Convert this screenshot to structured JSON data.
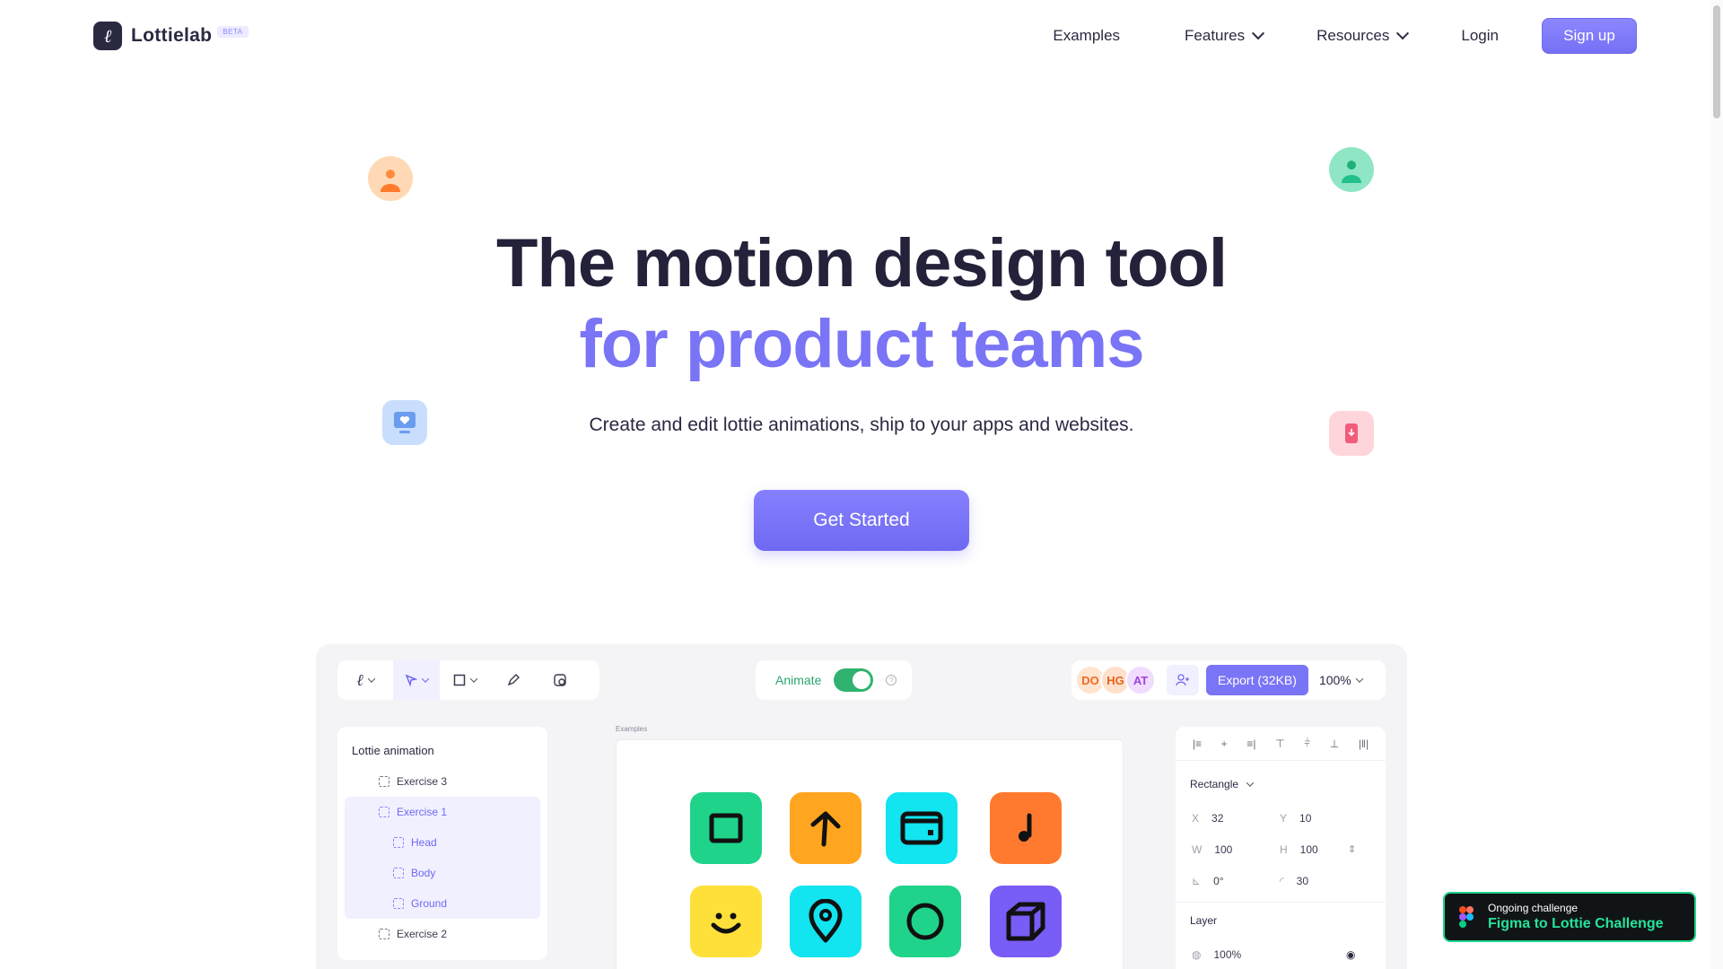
{
  "nav": {
    "logo_text": "Lottielab",
    "beta_label": "BETA",
    "links": {
      "examples": "Examples",
      "features": "Features",
      "resources": "Resources",
      "login": "Login"
    },
    "signup_label": "Sign up"
  },
  "hero": {
    "title_line1": "The motion design tool",
    "title_line2": "for product teams",
    "subtitle": "Create and edit lottie animations, ship to your apps and websites.",
    "cta_label": "Get Started"
  },
  "editor": {
    "animate_label": "Animate",
    "collaborators": [
      "DO",
      "HG",
      "AT"
    ],
    "export_label": "Export (32KB)",
    "zoom_label": "100%",
    "layers": {
      "title": "Lottie animation",
      "items": [
        "Exercise 3",
        "Exercise 1",
        "Head",
        "Body",
        "Ground",
        "Exercise 2"
      ]
    },
    "canvas_label": "Examples",
    "properties": {
      "shape_label": "Rectangle",
      "x_key": "X",
      "x_value": "32",
      "y_key": "Y",
      "y_value": "10",
      "w_key": "W",
      "w_value": "100",
      "h_key": "H",
      "h_value": "100",
      "rotation_value": "0°",
      "radius_value": "30",
      "layer_label": "Layer",
      "opacity_value": "100%"
    },
    "tiles": [
      {
        "icon": "square-icon",
        "color": "#1fd38a"
      },
      {
        "icon": "arrow-up-icon",
        "color": "#ffa51f"
      },
      {
        "icon": "wallet-icon",
        "color": "#12e4f0"
      },
      {
        "icon": "music-note-icon",
        "color": "#ff7a2f"
      },
      {
        "icon": "smile-icon",
        "color": "#ffe03a"
      },
      {
        "icon": "map-pin-icon",
        "color": "#12e4f0"
      },
      {
        "icon": "circle-icon",
        "color": "#1fd38a"
      },
      {
        "icon": "cube-icon",
        "color": "#7a5cf6"
      }
    ]
  },
  "challenge": {
    "top": "Ongoing challenge",
    "main": "Figma to Lottie Challenge"
  },
  "colors": {
    "accent": "#7a74f6",
    "heading": "#24223a",
    "success": "#2fb36f"
  }
}
